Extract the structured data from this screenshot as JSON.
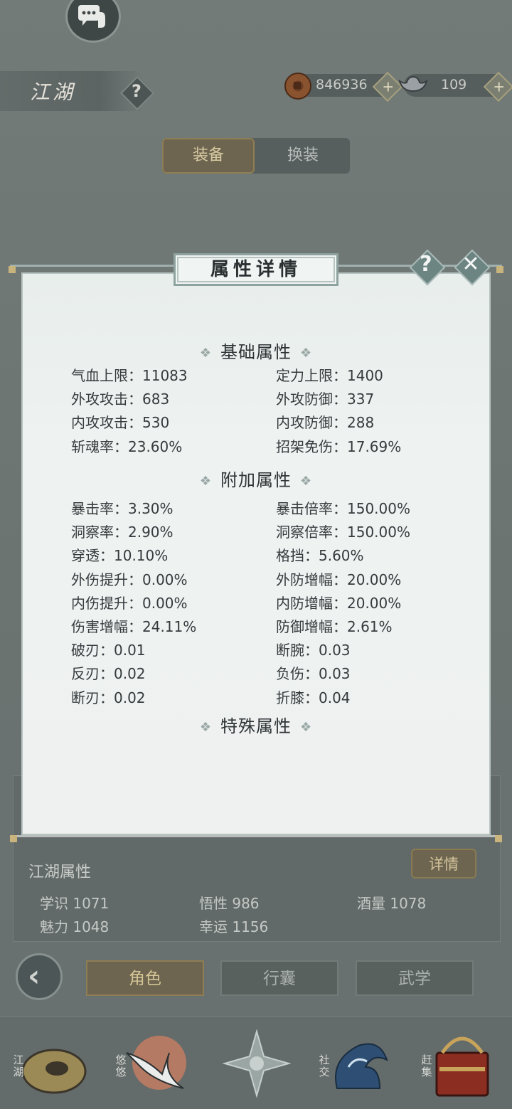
{
  "header": {
    "title": "江湖",
    "help_label": "?",
    "coins": "846936",
    "silver": "109",
    "plus_label": "+"
  },
  "tabs": [
    {
      "label": "装备",
      "active": true
    },
    {
      "label": "换装",
      "active": false
    }
  ],
  "modal": {
    "title": "属性详情",
    "help_label": "?",
    "close_label": "✕",
    "sections": [
      {
        "title": "基础属性"
      },
      {
        "title": "附加属性"
      },
      {
        "title": "特殊属性"
      }
    ],
    "basic": [
      {
        "label": "气血上限：11083"
      },
      {
        "label": "定力上限：1400"
      },
      {
        "label": "外攻攻击：683"
      },
      {
        "label": "外攻防御：337"
      },
      {
        "label": "内攻攻击：530"
      },
      {
        "label": "内攻防御：288"
      },
      {
        "label": "斩魂率：23.60%"
      },
      {
        "label": "招架免伤：17.69%"
      }
    ],
    "extra": [
      {
        "label": "暴击率：3.30%"
      },
      {
        "label": "暴击倍率：150.00%"
      },
      {
        "label": "洞察率：2.90%"
      },
      {
        "label": "洞察倍率：150.00%"
      },
      {
        "label": "穿透：10.10%"
      },
      {
        "label": "格挡：5.60%"
      },
      {
        "label": "外伤提升：0.00%"
      },
      {
        "label": "外防增幅：20.00%"
      },
      {
        "label": "内伤提升：0.00%"
      },
      {
        "label": "内防增幅：20.00%"
      },
      {
        "label": "伤害增幅：24.11%"
      },
      {
        "label": "防御增幅：2.61%"
      },
      {
        "label": "破刃：0.01"
      },
      {
        "label": "断腕：0.03"
      },
      {
        "label": "反刃：0.02"
      },
      {
        "label": "负伤：0.03"
      },
      {
        "label": "断刃：0.02"
      },
      {
        "label": "折膝：0.04"
      }
    ]
  },
  "jianghu": {
    "title": "江湖属性",
    "detail_button": "详情",
    "stats": [
      {
        "label": "学识  1071"
      },
      {
        "label": "悟性  986"
      },
      {
        "label": "酒量  1078"
      },
      {
        "label": "魅力  1048"
      },
      {
        "label": "幸运  1156"
      }
    ]
  },
  "bottom_tabs": [
    {
      "label": "角色",
      "active": true
    },
    {
      "label": "行囊",
      "active": false
    },
    {
      "label": "武学",
      "active": false
    }
  ],
  "dock": [
    {
      "label": "江湖",
      "icon": "straw-hat-icon"
    },
    {
      "label": "悠悠",
      "icon": "crane-icon"
    },
    {
      "label": "",
      "icon": "compass-star-icon"
    },
    {
      "label": "社交",
      "icon": "wave-icon"
    },
    {
      "label": "赶集",
      "icon": "basket-icon"
    }
  ]
}
